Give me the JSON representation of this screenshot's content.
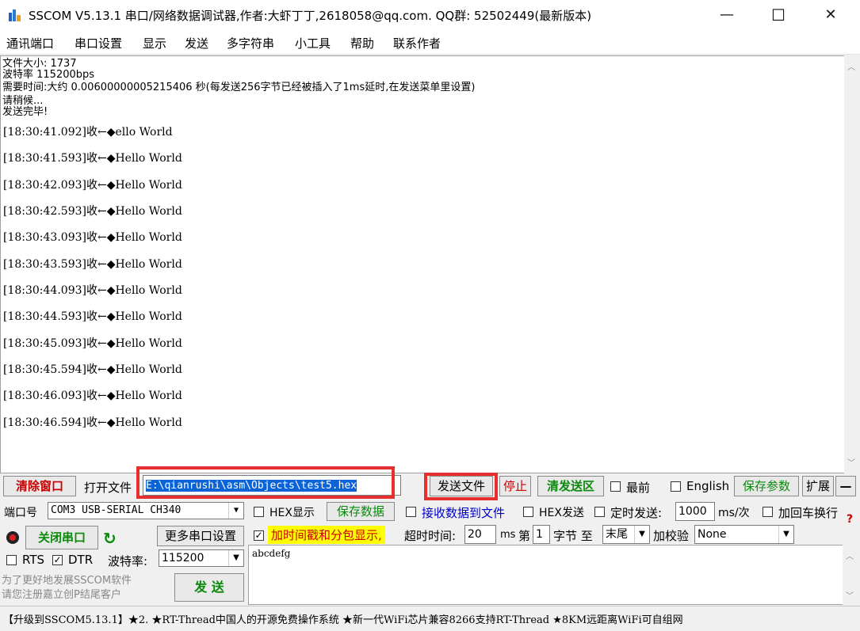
{
  "window": {
    "title": "SSCOM V5.13.1 串口/网络数据调试器,作者:大虾丁丁,2618058@qq.com. QQ群:  52502449(最新版本)",
    "minimize": "—",
    "maximize": "☐",
    "close": "✕"
  },
  "menu": [
    "通讯端口",
    "串口设置",
    "显示",
    "发送",
    "多字符串",
    "小工具",
    "帮助",
    "联系作者"
  ],
  "receive": {
    "info_lines": [
      "文件大小: 1737",
      "波特率 115200bps",
      "需要时间:大约 0.00600000005215406 秒(每发送256字节已经被插入了1ms延时,在发送菜单里设置)",
      "请稍候...",
      "发送完毕!"
    ],
    "lines": [
      "[18:30:41.092]收←◆ello World",
      "[18:30:41.593]收←◆Hello World",
      "[18:30:42.093]收←◆Hello World",
      "[18:30:42.593]收←◆Hello World",
      "[18:30:43.093]收←◆Hello World",
      "[18:30:43.593]收←◆Hello World",
      "[18:30:44.093]收←◆Hello World",
      "[18:30:44.593]收←◆Hello World",
      "[18:30:45.093]收←◆Hello World",
      "[18:30:45.594]收←◆Hello World",
      "[18:30:46.093]收←◆Hello World",
      "[18:30:46.594]收←◆Hello World"
    ]
  },
  "toolbar": {
    "clear_window": "清除窗口",
    "open_file": "打开文件",
    "file_path": "E:\\qianrushi\\asm\\Objects\\test5.hex",
    "send_file": "发送文件",
    "stop": "停止",
    "clear_send": "清发送区",
    "topmost": "最前",
    "english": "English",
    "save_params": "保存参数",
    "expand": "扩展",
    "collapse": "—"
  },
  "port": {
    "port_label": "端口号",
    "port_value": "COM3 USB-SERIAL CH340",
    "close_port": "关闭串口",
    "more_settings": "更多串口设置",
    "rts": "RTS",
    "dtr": "DTR",
    "baud_label": "波特率:",
    "baud_value": "115200",
    "promo1": "为了更好地发展SSCOM软件",
    "promo2": "请您注册嘉立创P结尾客户",
    "send_btn": "发 送"
  },
  "options": {
    "hex_display": "HEX显示",
    "save_data": "保存数据",
    "recv_to_file": "接收数据到文件",
    "hex_send": "HEX发送",
    "timed_send": "定时发送:",
    "interval": "1000",
    "interval_unit": "ms/次",
    "add_crlf": "加回车换行",
    "timestamp": "加时间戳和分包显示,",
    "timeout_label": "超时时间:",
    "timeout_value": "20",
    "timeout_unit": "ms",
    "nth_label": "第",
    "nth_value": "1",
    "byte_to": "字节 至",
    "end_value": "末尾",
    "checksum_label": "加校验",
    "checksum_value": "None"
  },
  "send_text": "abcdefg",
  "status_bar": "【升级到SSCOM5.13.1】★2. ★RT-Thread中国人的开源免费操作系统 ★新一代WiFi芯片兼容8266支持RT-Thread ★8KM远距离WiFi可自组网",
  "colors": {
    "red_highlight": "#e63030",
    "selection": "#0a64d8",
    "yellow_highlight": "#ffff00",
    "green_text": "#0a8a0a",
    "blue_text": "#0000cc",
    "red_text": "#cc0000"
  }
}
